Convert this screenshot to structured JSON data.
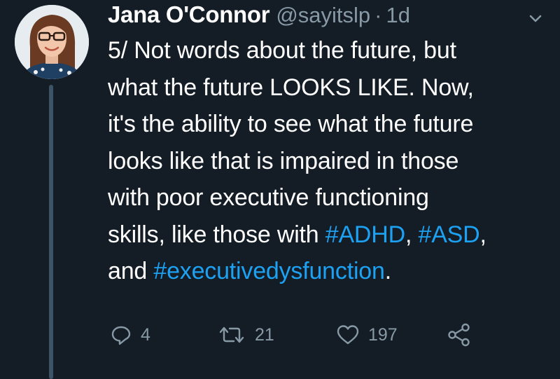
{
  "tweet": {
    "author_name": "Jana O'Connor",
    "handle": "@sayitslp",
    "separator": "·",
    "time": "1d",
    "body_lines": [
      [
        {
          "t": "5/ Not words about the future, but"
        }
      ],
      [
        {
          "t": "what the future LOOKS LIKE. Now,"
        }
      ],
      [
        {
          "t": "it's the ability to see what the future"
        }
      ],
      [
        {
          "t": "looks like that is impaired in those"
        }
      ],
      [
        {
          "t": "with poor executive functioning"
        }
      ],
      [
        {
          "t": "skills, like those with "
        },
        {
          "t": "#ADHD",
          "tag": true
        },
        {
          "t": ", "
        },
        {
          "t": "#ASD",
          "tag": true
        },
        {
          "t": ","
        }
      ],
      [
        {
          "t": "and "
        },
        {
          "t": "#executivedysfunction",
          "tag": true
        },
        {
          "t": "."
        }
      ]
    ],
    "reply_count": "4",
    "retweet_count": "21",
    "like_count": "197"
  },
  "icons": {
    "reply": "reply-icon",
    "retweet": "retweet-icon",
    "like": "heart-icon",
    "share": "share-icon",
    "menu": "chevron-down-icon"
  },
  "colors": {
    "background": "#141d26",
    "text": "#ffffff",
    "muted": "#8899a6",
    "hashtag": "#1da1f2",
    "thread_line": "#3d5466"
  }
}
